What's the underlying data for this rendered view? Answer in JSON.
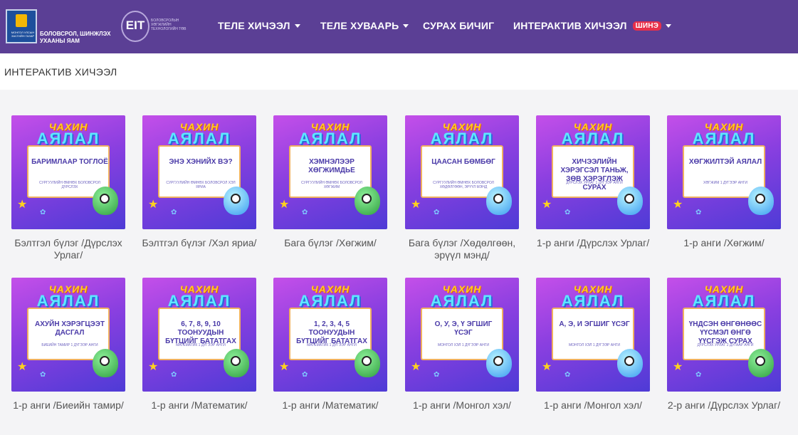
{
  "header": {
    "ministry_emblem_text": "МОНГОЛ УЛСЫН ЗАСГИЙН ГАЗАР",
    "ministry_name": "БОЛОВСРОЛ, ШИНЖЛЭХ УХААНЫ ЯАМ",
    "eit_mark": "EIT",
    "eit_text": "БОЛОВСРОЛЫН ХӨГЖЛИЙН ТЕХНОЛОГИЙН ТӨВ",
    "nav": [
      {
        "label": "ТЕЛЕ ХИЧЭЭЛ",
        "has_dropdown": true
      },
      {
        "label": "ТЕЛЕ ХУВААРЬ",
        "has_dropdown": true
      },
      {
        "label": "СУРАХ БИЧИГ",
        "has_dropdown": false
      },
      {
        "label": "ИНТЕРАКТИВ ХИЧЭЭЛ",
        "has_dropdown": true,
        "badge": "ШИНЭ"
      }
    ]
  },
  "page": {
    "title": "ИНТЕРАКТИВ ХИЧЭЭЛ"
  },
  "game_logo": {
    "top": "ЧАХИН",
    "bottom": "АЯЛАЛ"
  },
  "cards": [
    {
      "panel_title": "БАРИМЛААР ТОГЛОЁ",
      "panel_sub": "СУРГУУЛИЙН ӨМНӨХ БОЛОВСРОЛ ДҮРСЛЭХ",
      "caption": "Бэлтгэл бүлэг /Дүрслэх Урлаг/",
      "mascot": "green"
    },
    {
      "panel_title": "ЭНЭ ХЭНИЙХ ВЭ?",
      "panel_sub": "СУРГУУЛИЙН ӨМНӨХ БОЛОВСРОЛ ХЭЛ ЯРИА",
      "caption": "Бэлтгэл бүлэг /Хэл яриа/",
      "mascot": "blue"
    },
    {
      "panel_title": "ХЭМНЭЛЭЭР ХӨГЖИМДЬЕ",
      "panel_sub": "СУРГУУЛИЙН ӨМНӨХ БОЛОВСРОЛ ХӨГЖИМ",
      "caption": "Бага бүлэг /Хөгжим/",
      "mascot": "green"
    },
    {
      "panel_title": "ЦААСАН БӨМБӨГ",
      "panel_sub": "СУРГУУЛИЙН ӨМНӨХ БОЛОВСРОЛ ХӨДӨЛГӨӨН, ЭРҮҮЛ МЭНД",
      "caption": "Бага бүлэг /Хөдөлгөөн, эрүүл мэнд/",
      "mascot": "blue"
    },
    {
      "panel_title": "ХИЧЭЭЛИЙН ХЭРЭГСЭЛ ТАНЬЖ, ЗӨВ ХЭРЭГЛЭЖ СУРАХ",
      "panel_sub": "ДҮРСЛЭХ УРЛАГ 1 ДҮГЭЭР АНГИ",
      "caption": "1-р анги /Дүрслэх Урлаг/",
      "mascot": "blue"
    },
    {
      "panel_title": "ХӨГЖИЛТЭЙ АЯЛАЛ",
      "panel_sub": "ХӨГЖИМ 1 ДҮГЭЭР АНГИ",
      "caption": "1-р анги /Хөгжим/",
      "mascot": "blue"
    },
    {
      "panel_title": "АХУЙН ХЭРЭГЦЭЭТ ДАСГАЛ",
      "panel_sub": "БИЕИЙН ТАМИР 1 ДҮГЭЭР АНГИ",
      "caption": "1-р анги /Биеийн тамир/",
      "mascot": "green"
    },
    {
      "panel_title": "6, 7, 8, 9, 10 ТООНУУДЫН БҮТЦИЙГ БАТАТГАХ",
      "panel_sub": "МАТЕМАТИК 1 ДҮГЭЭР АНГИ",
      "caption": "1-р анги /Математик/",
      "mascot": "green"
    },
    {
      "panel_title": "1, 2, 3, 4, 5 ТООНУУДЫН БҮТЦИЙГ БАТАТГАХ",
      "panel_sub": "МАТЕМАТИК 1 ДҮГЭЭР АНГИ",
      "caption": "1-р анги /Математик/",
      "mascot": "green"
    },
    {
      "panel_title": "О, У, Э, Ү ЭГШИГ ҮСЭГ",
      "panel_sub": "МОНГОЛ ХЭЛ 1 ДҮГЭЭР АНГИ",
      "caption": "1-р анги /Монгол хэл/",
      "mascot": "blue"
    },
    {
      "panel_title": "А, Э, И ЭГШИГ ҮСЭГ",
      "panel_sub": "МОНГОЛ ХЭЛ 1 ДҮГЭЭР АНГИ",
      "caption": "1-р анги /Монгол хэл/",
      "mascot": "blue"
    },
    {
      "panel_title": "ҮНДСЭН ӨНГӨНӨӨС ҮҮСМЭЛ ӨНГӨ ҮҮСГЭЖ СУРАХ",
      "panel_sub": "ДҮРСЛЭХ УРЛАГ 2 ДУГААР АНГИ",
      "caption": "2-р анги /Дүрслэх Урлаг/",
      "mascot": "green"
    }
  ]
}
